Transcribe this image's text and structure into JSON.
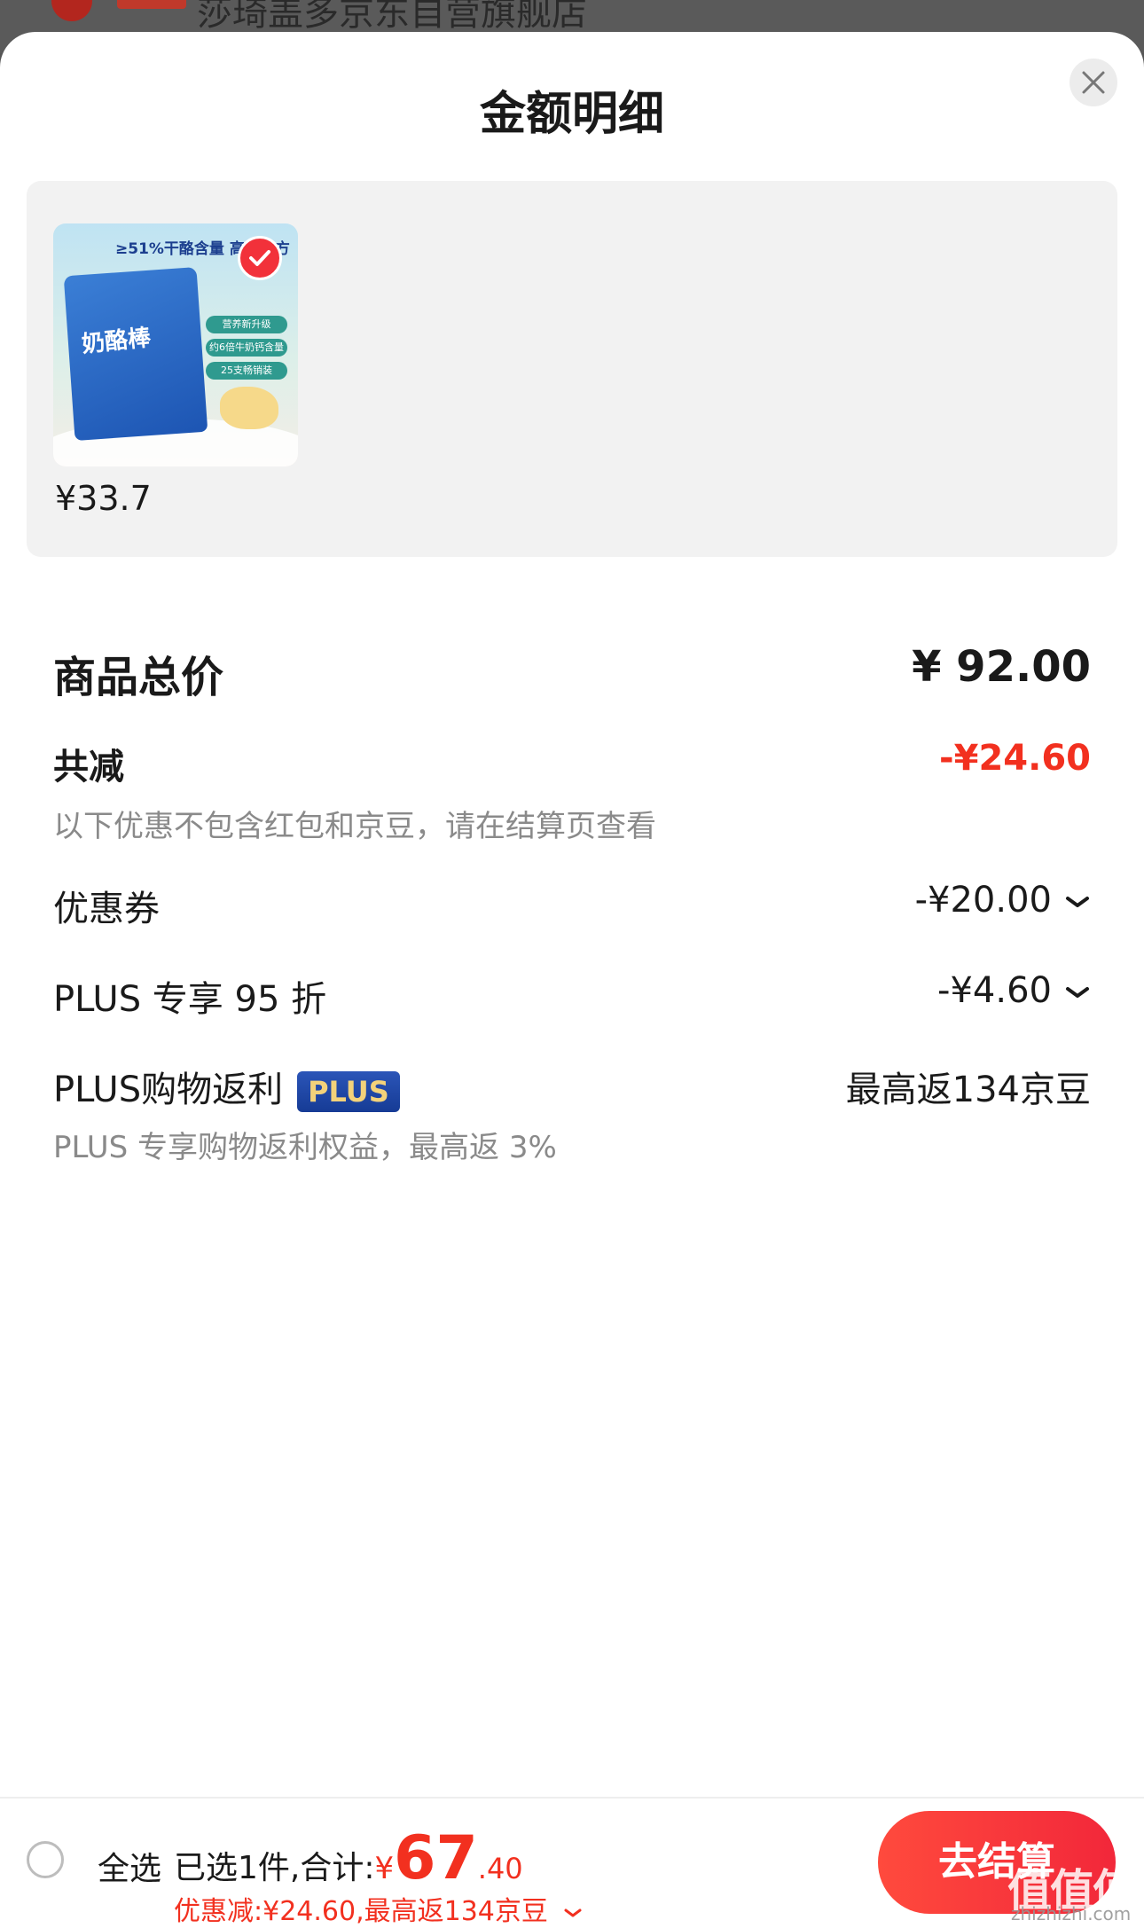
{
  "background": {
    "store_name_partial": "莎琦盖多京东自营旗舰店"
  },
  "sheet": {
    "title": "金额明细"
  },
  "product": {
    "thumb_top_text": "≥51%干酪含量 高钙配方",
    "thumb_bag_text": "奶酪棒",
    "thumb_pills": [
      "营养新升级",
      "约6倍牛奶钙含量",
      "25支畅销装"
    ],
    "price": "¥33.7",
    "selected": true
  },
  "summary": {
    "total_label": "商品总价",
    "total_value": "¥ 92.00",
    "reduce_label": "共减",
    "reduce_value": "-¥24.60",
    "note": "以下优惠不包含红包和京豆，请在结算页查看",
    "coupon_label": "优惠券",
    "coupon_value": "-¥20.00",
    "plus95_label": "PLUS 专享 95 折",
    "plus95_value": "-¥4.60",
    "rebate_label": "PLUS购物返利",
    "rebate_badge": "PLUS",
    "rebate_value": "最高返134京豆",
    "rebate_note": "PLUS 专享购物返利权益，最高返 3%"
  },
  "bottom": {
    "select_all": "全选",
    "selected_count": "已选1件,合计:",
    "currency": "¥",
    "total_int": "67",
    "total_dec": ".40",
    "discount_line": "优惠减:¥24.60,最高返134京豆",
    "checkout": "去结算",
    "watermark": "值值值",
    "watermark_sub": "zhizhizhi.com"
  },
  "colors": {
    "accent_red": "#f2301f",
    "plus_blue": "#163b95",
    "plus_gold": "#f3d27a"
  }
}
